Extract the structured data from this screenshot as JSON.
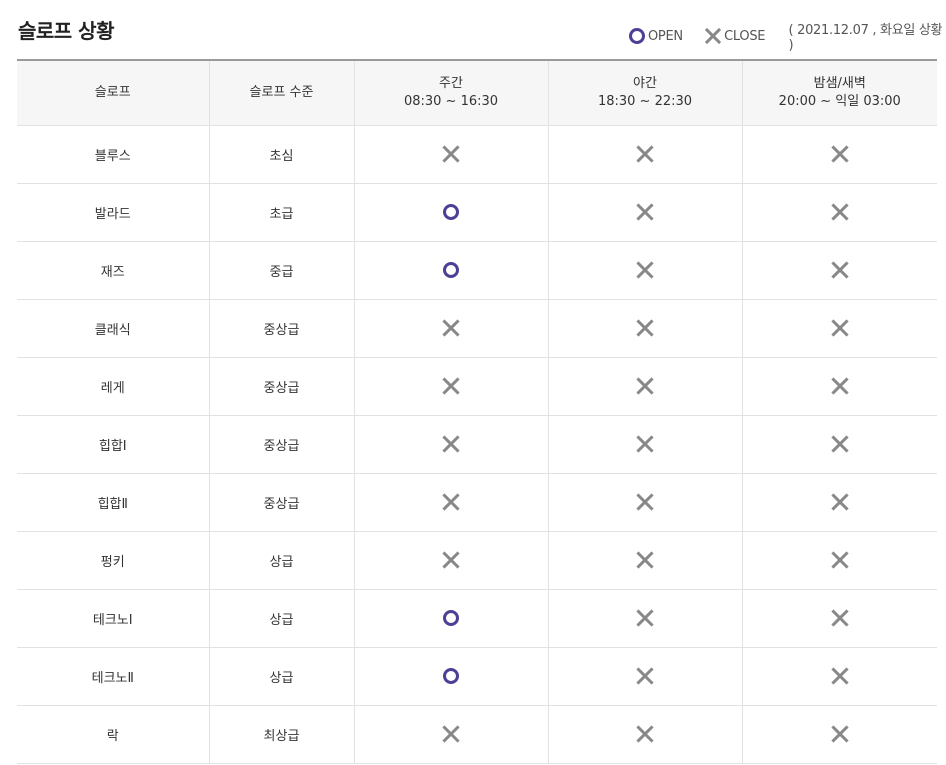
{
  "page": {
    "title": "슬로프 상황"
  },
  "legend": {
    "open_label": "OPEN",
    "close_label": "CLOSE",
    "date_note": "( 2021.12.07 , 화요일 상황 )"
  },
  "colors": {
    "open": "#4b3f96",
    "close": "#888888"
  },
  "table": {
    "headers": [
      {
        "label": "슬로프",
        "time": ""
      },
      {
        "label": "슬로프 수준",
        "time": ""
      },
      {
        "label": "주간",
        "time": "08:30 ~ 16:30"
      },
      {
        "label": "야간",
        "time": "18:30 ~ 22:30"
      },
      {
        "label": "밤샘/새벽",
        "time": "20:00 ~ 익일 03:00"
      }
    ],
    "rows": [
      {
        "slope": "블루스",
        "level": "초심",
        "status": [
          "close",
          "close",
          "close"
        ]
      },
      {
        "slope": "발라드",
        "level": "초급",
        "status": [
          "open",
          "close",
          "close"
        ]
      },
      {
        "slope": "재즈",
        "level": "중급",
        "status": [
          "open",
          "close",
          "close"
        ]
      },
      {
        "slope": "클래식",
        "level": "중상급",
        "status": [
          "close",
          "close",
          "close"
        ]
      },
      {
        "slope": "레게",
        "level": "중상급",
        "status": [
          "close",
          "close",
          "close"
        ]
      },
      {
        "slope": "힙합Ⅰ",
        "level": "중상급",
        "status": [
          "close",
          "close",
          "close"
        ]
      },
      {
        "slope": "힙합Ⅱ",
        "level": "중상급",
        "status": [
          "close",
          "close",
          "close"
        ]
      },
      {
        "slope": "펑키",
        "level": "상급",
        "status": [
          "close",
          "close",
          "close"
        ]
      },
      {
        "slope": "테크노Ⅰ",
        "level": "상급",
        "status": [
          "open",
          "close",
          "close"
        ]
      },
      {
        "slope": "테크노Ⅱ",
        "level": "상급",
        "status": [
          "open",
          "close",
          "close"
        ]
      },
      {
        "slope": "락",
        "level": "최상급",
        "status": [
          "close",
          "close",
          "close"
        ]
      }
    ]
  }
}
